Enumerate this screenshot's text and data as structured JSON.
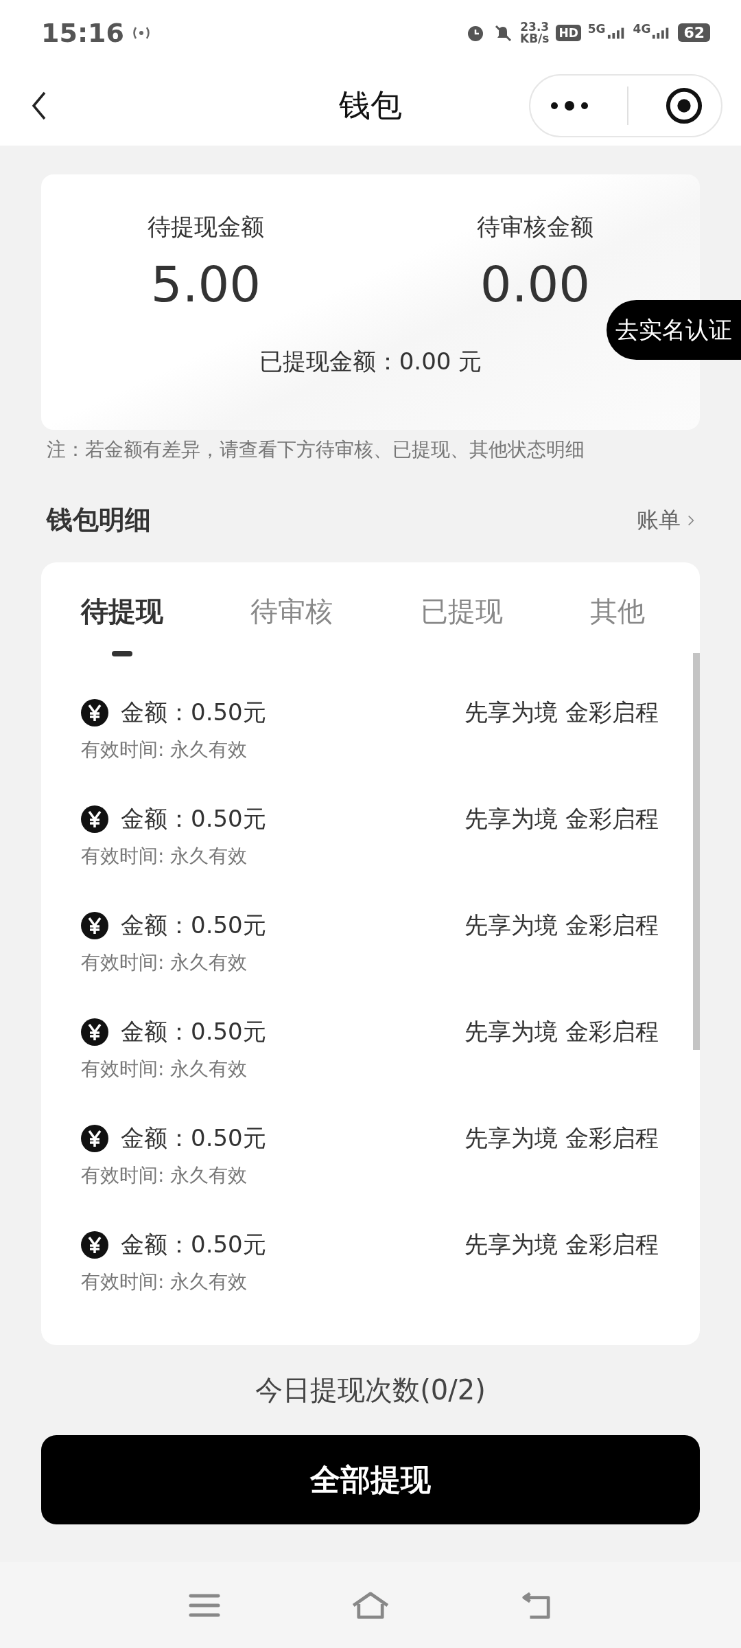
{
  "status_bar": {
    "time": "15:16",
    "net_speed": "23.3",
    "net_unit": "KB/s",
    "hd": "HD",
    "networks": [
      "5G",
      "4G"
    ],
    "battery": "62"
  },
  "nav": {
    "title": "钱包"
  },
  "summary": {
    "items": [
      {
        "label": "待提现金额",
        "value": "5.00"
      },
      {
        "label": "待审核金额",
        "value": "0.00"
      }
    ],
    "withdrawn": "已提现金额：0.00 元",
    "badge": "去实名认证"
  },
  "note": "注：若金额有差异，请查看下方待审核、已提现、其他状态明细",
  "section": {
    "title": "钱包明细",
    "link": "账单"
  },
  "tabs": [
    {
      "label": "待提现",
      "selected": true
    },
    {
      "label": "待审核",
      "selected": false
    },
    {
      "label": "已提现",
      "selected": false
    },
    {
      "label": "其他",
      "selected": false
    }
  ],
  "records": [
    {
      "amount": "金额：0.50元",
      "title": "先享为境 金彩启程",
      "validity": "有效时间: 永久有效"
    },
    {
      "amount": "金额：0.50元",
      "title": "先享为境 金彩启程",
      "validity": "有效时间: 永久有效"
    },
    {
      "amount": "金额：0.50元",
      "title": "先享为境 金彩启程",
      "validity": "有效时间: 永久有效"
    },
    {
      "amount": "金额：0.50元",
      "title": "先享为境 金彩启程",
      "validity": "有效时间: 永久有效"
    },
    {
      "amount": "金额：0.50元",
      "title": "先享为境 金彩启程",
      "validity": "有效时间: 永久有效"
    },
    {
      "amount": "金额：0.50元",
      "title": "先享为境 金彩启程",
      "validity": "有效时间: 永久有效"
    }
  ],
  "count": "今日提现次数(0/2)",
  "button": "全部提现"
}
